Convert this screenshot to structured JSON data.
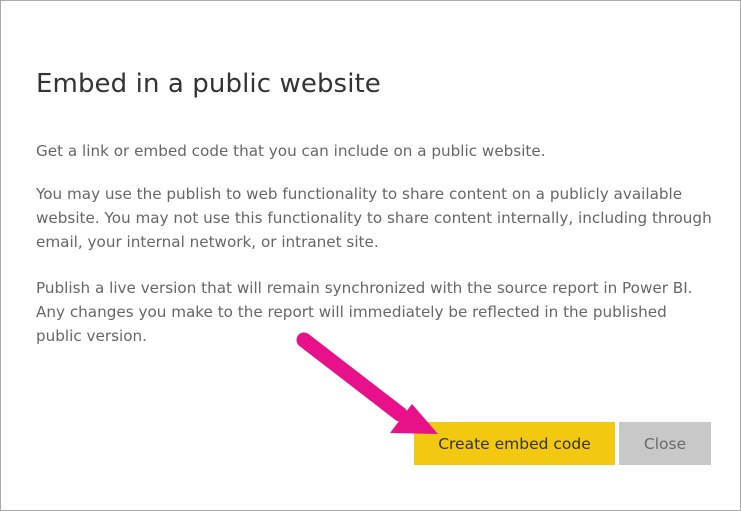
{
  "dialog": {
    "title": "Embed in a public website",
    "paragraphs": [
      "Get a link or embed code that you can include on a public website.",
      "You may use the publish to web functionality to share content on a publicly available website. You may not use this functionality to share content internally, including through email, your internal network, or intranet site.",
      "Publish a live version that will remain synchronized with the source report in Power BI. Any changes you make to the report will immediately be reflected in the published public version."
    ],
    "buttons": {
      "primary_label": "Create embed code",
      "secondary_label": "Close"
    }
  },
  "annotation": {
    "arrow_icon": "pointer-arrow-icon",
    "arrow_color": "#e8118a"
  },
  "colors": {
    "primary_button": "#f2c811",
    "secondary_button": "#c8c8c8",
    "title_text": "#333333",
    "body_text": "#666666"
  }
}
